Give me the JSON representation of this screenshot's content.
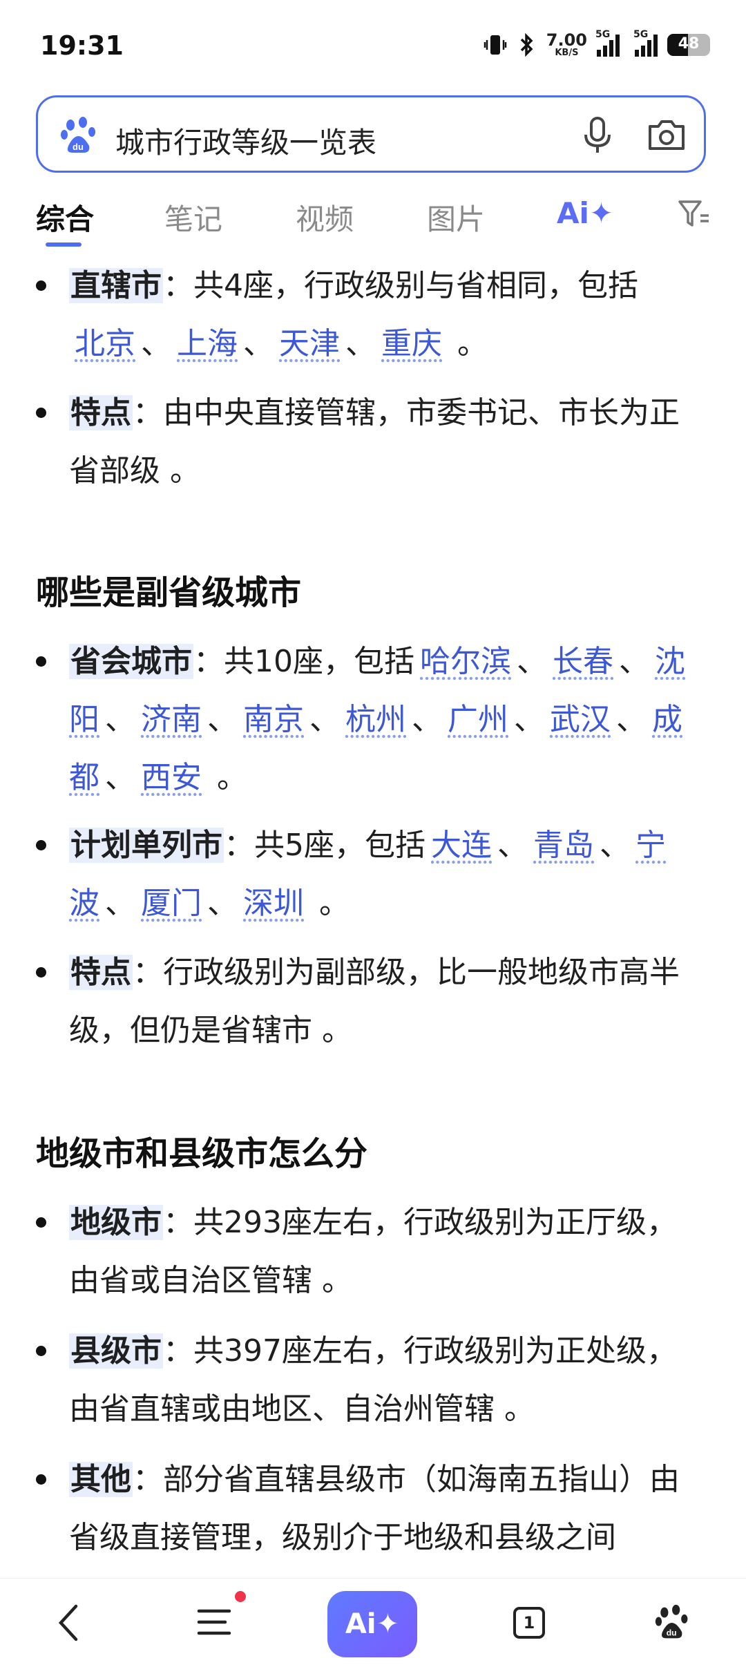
{
  "status_bar": {
    "time": "19:31",
    "net_speed": "7.00",
    "net_unit": "KB/S",
    "sim1": "5G",
    "sim2": "5G",
    "battery": "48"
  },
  "search": {
    "query": "城市行政等级一览表"
  },
  "tabs": [
    "综合",
    "笔记",
    "视频",
    "图片"
  ],
  "ai_tab": "Ai✦",
  "sections": [
    {
      "title": ""
    },
    {
      "title": "哪些是副省级城市"
    },
    {
      "title": "地级市和县级市怎么分"
    }
  ],
  "bullets": {
    "b1": {
      "kw": "直辖市",
      "pre": "：共4座，行政级别与省相同，包括",
      "links": [
        "北京",
        "上海",
        "天津",
        "重庆"
      ],
      "post": "。"
    },
    "b2": {
      "kw": "特点",
      "text": "：由中央直接管辖，市委书记、市长为正省部级 。"
    },
    "b3": {
      "kw": "省会城市",
      "pre": "：共10座，包括",
      "links": [
        "哈尔滨",
        "长春",
        "沈阳",
        "济南",
        "南京",
        "杭州",
        "广州",
        "武汉",
        "成都",
        "西安"
      ],
      "post": "。"
    },
    "b4": {
      "kw": "计划单列市",
      "pre": "：共5座，包括",
      "links": [
        "大连",
        "青岛",
        "宁波",
        "厦门",
        "深圳"
      ],
      "post": "。"
    },
    "b5": {
      "kw": "特点",
      "text": "：行政级别为副部级，比一般地级市高半级，但仍是省辖市 。"
    },
    "b6": {
      "kw": "地级市",
      "text": "：共293座左右，行政级别为正厅级，由省或自治区管辖 。"
    },
    "b7": {
      "kw": "县级市",
      "text": "：共397座左右，行政级别为正处级，由省直辖或由地区、自治州管辖 。"
    },
    "b8": {
      "kw": "其他",
      "text": "：部分省直辖县级市（如海南五指山）由省级直接管理，级别介于地级和县级之间"
    }
  },
  "separator": "、",
  "bottom_nav": {
    "ai_label": "Ai✦",
    "tab_count": "1"
  },
  "colors": {
    "accent": "#4e6ef2",
    "link": "#3c58d6",
    "notification": "#f0334a"
  }
}
